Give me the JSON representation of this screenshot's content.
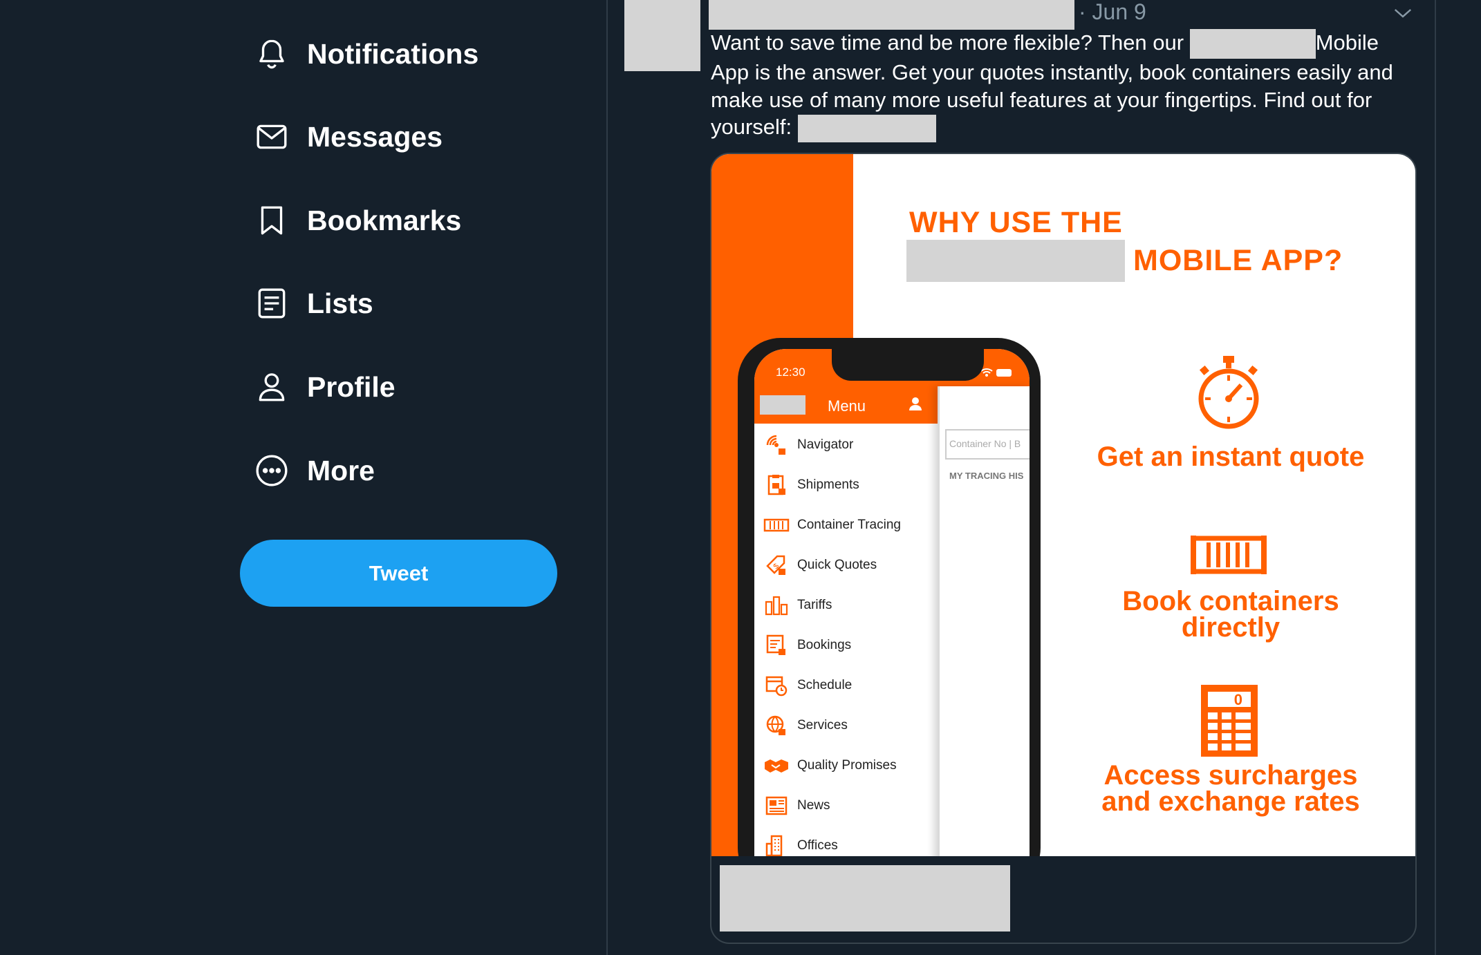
{
  "sidebar": {
    "items": [
      {
        "label": "Notifications",
        "icon": "bell-icon"
      },
      {
        "label": "Messages",
        "icon": "envelope-icon"
      },
      {
        "label": "Bookmarks",
        "icon": "bookmark-icon"
      },
      {
        "label": "Lists",
        "icon": "list-icon"
      },
      {
        "label": "Profile",
        "icon": "person-icon"
      },
      {
        "label": "More",
        "icon": "more-circle-icon"
      }
    ],
    "tweet_button": "Tweet"
  },
  "tweet": {
    "date": "· Jun 9",
    "text_part1": "Want to save time and be more flexible? Then our",
    "text_part2": "Mobile App is the answer. Get your quotes instantly, book containers easily and make use of many more useful features at your fingertips. Find out for yourself:",
    "card": {
      "title_line1": "WHY USE THE",
      "title_line2": "MOBILE APP?",
      "features": [
        {
          "label": "Get an instant quote",
          "icon": "stopwatch-icon"
        },
        {
          "label_line1": "Book containers",
          "label_line2": "directly",
          "icon": "container-icon"
        },
        {
          "label_line1": "Access surcharges",
          "label_line2": "and exchange rates",
          "icon": "calculator-icon"
        }
      ],
      "phone": {
        "time": "12:30",
        "menu_title": "Menu",
        "side_input_placeholder": "Container No | B",
        "side_history": "MY TRACING HIS",
        "menu_items": [
          "Navigator",
          "Shipments",
          "Container Tracing",
          "Quick Quotes",
          "Tariffs",
          "Bookings",
          "Schedule",
          "Services",
          "Quality Promises",
          "News",
          "Offices"
        ]
      }
    }
  },
  "colors": {
    "background": "#15202b",
    "accent_blue": "#1da1f2",
    "brand_orange": "#ff6000",
    "muted": "#8899a6"
  }
}
